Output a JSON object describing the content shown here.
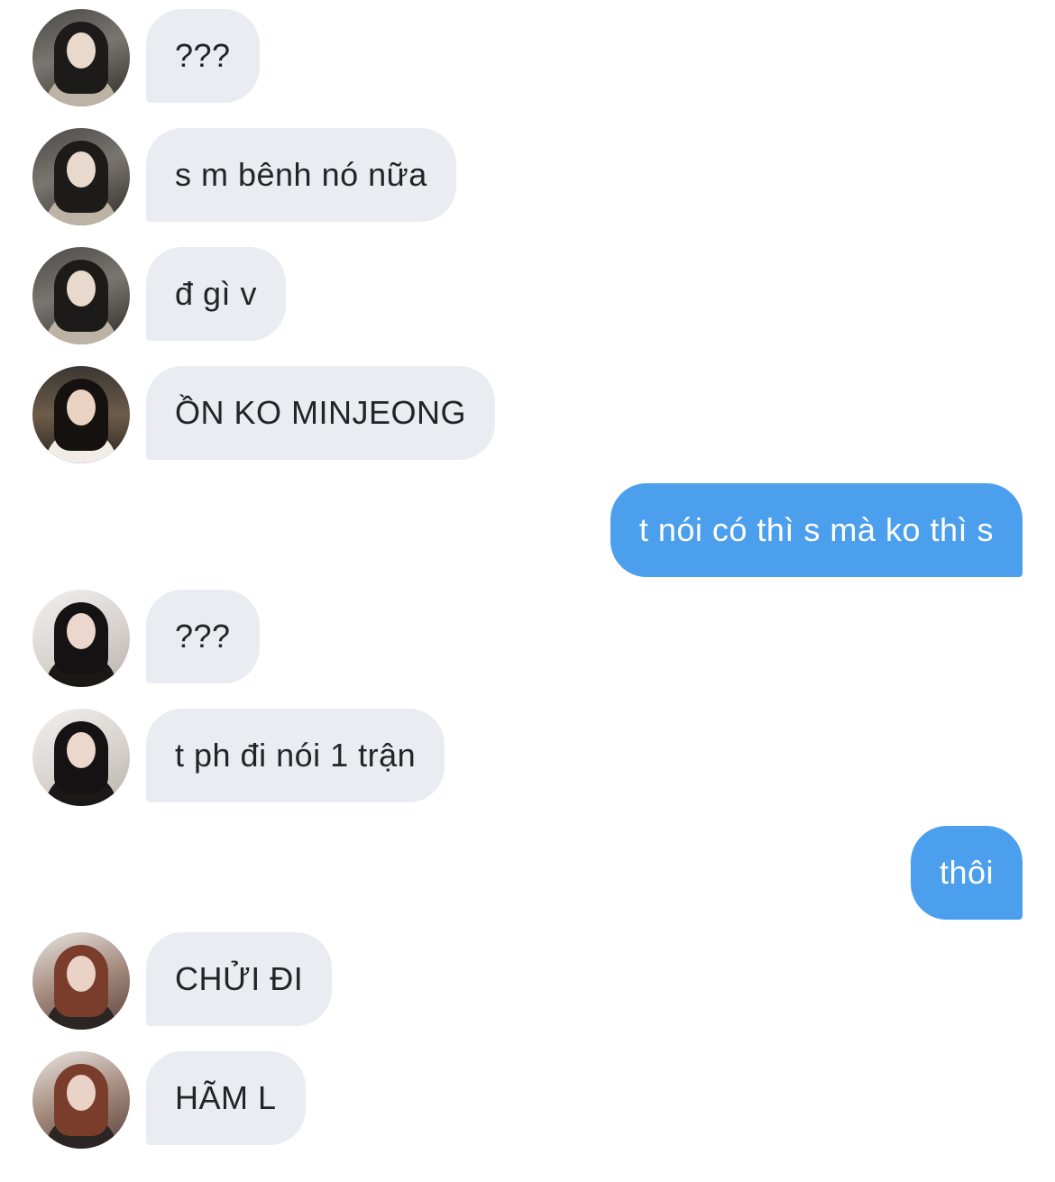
{
  "conversation": {
    "messages": [
      {
        "direction": "in",
        "avatar": "avatar-a",
        "text": "???"
      },
      {
        "direction": "in",
        "avatar": "avatar-a",
        "text": "s m bênh nó nữa"
      },
      {
        "direction": "in",
        "avatar": "avatar-a",
        "text": "đ gì v"
      },
      {
        "direction": "in",
        "avatar": "avatar-b",
        "text": "ỒN KO MINJEONG"
      },
      {
        "direction": "out",
        "text": "t nói có thì s mà ko thì s"
      },
      {
        "direction": "in",
        "avatar": "avatar-c",
        "text": "???"
      },
      {
        "direction": "in",
        "avatar": "avatar-c",
        "text": "t ph đi nói 1 trận"
      },
      {
        "direction": "out",
        "text": "thôi"
      },
      {
        "direction": "in",
        "avatar": "avatar-d",
        "text": "CHỬI ĐI"
      },
      {
        "direction": "in",
        "avatar": "avatar-d",
        "text": "HÃM L"
      }
    ]
  },
  "colors": {
    "incoming_bubble": "#e9ecf0",
    "outgoing_bubble": "#4b9fec",
    "incoming_text": "#222426",
    "outgoing_text": "#ffffff"
  }
}
